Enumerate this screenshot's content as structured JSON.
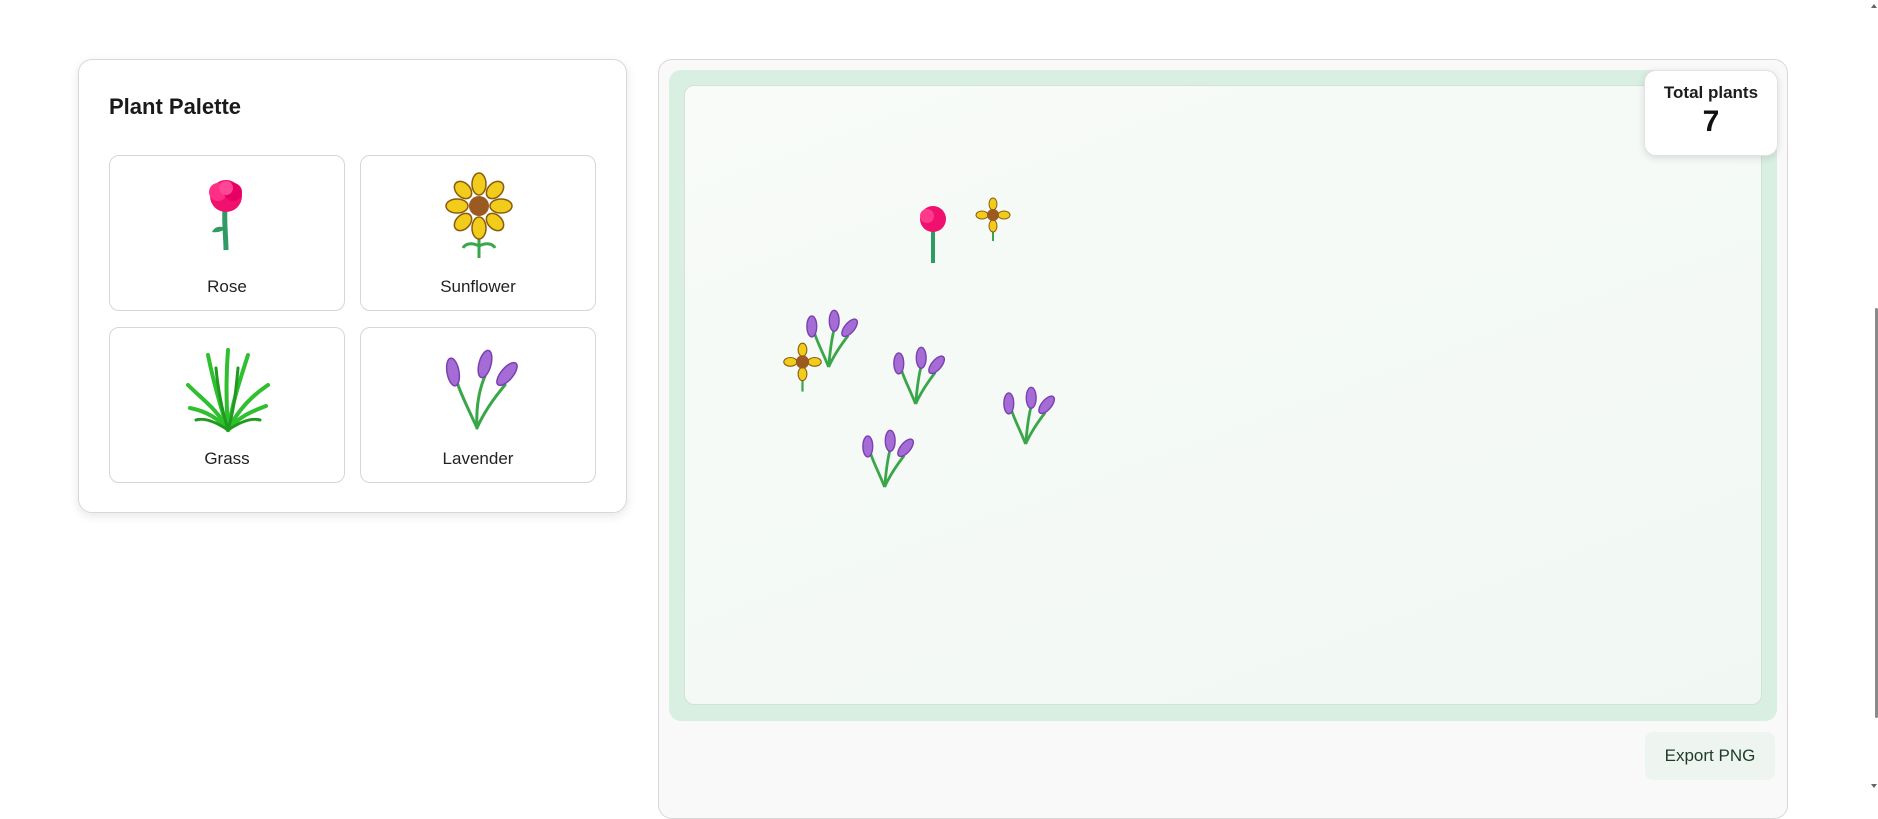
{
  "palette": {
    "title": "Plant Palette",
    "items": [
      {
        "label": "Rose",
        "icon": "rose-icon"
      },
      {
        "label": "Sunflower",
        "icon": "sunflower-icon"
      },
      {
        "label": "Grass",
        "icon": "grass-icon"
      },
      {
        "label": "Lavender",
        "icon": "lavender-icon"
      }
    ]
  },
  "garden": {
    "counter_label": "Total plants",
    "counter_value": "7",
    "plants": [
      "rose",
      "sunflower",
      "sunflower",
      "lavender",
      "lavender",
      "lavender",
      "lavender"
    ]
  },
  "actions": {
    "export_label": "Export PNG"
  },
  "colors": {
    "canvas_frame": "#d8efe2",
    "rose": "#f0106e",
    "sunflower_petal": "#f2cc1a",
    "lavender": "#a66cd6",
    "stem": "#3aa64a"
  }
}
